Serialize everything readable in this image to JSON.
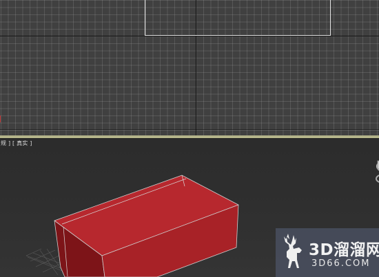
{
  "viewports": {
    "top": {
      "name": "top-viewport"
    },
    "perspective": {
      "label": "[透视] [真实]",
      "label_visible": "规 ] [ 真实 ]"
    }
  },
  "scene": {
    "object": {
      "type": "box",
      "color": "#b3262c",
      "edge_color": "#d8d8d8"
    }
  },
  "watermark": {
    "title": "3D溜溜网",
    "url": "3D66.COM"
  },
  "colors": {
    "viewport_top_bg": "#404040",
    "viewport_persp_bg": "#2f2f2f",
    "divider": "#b4b48a",
    "selection": "#e6e6e6"
  }
}
